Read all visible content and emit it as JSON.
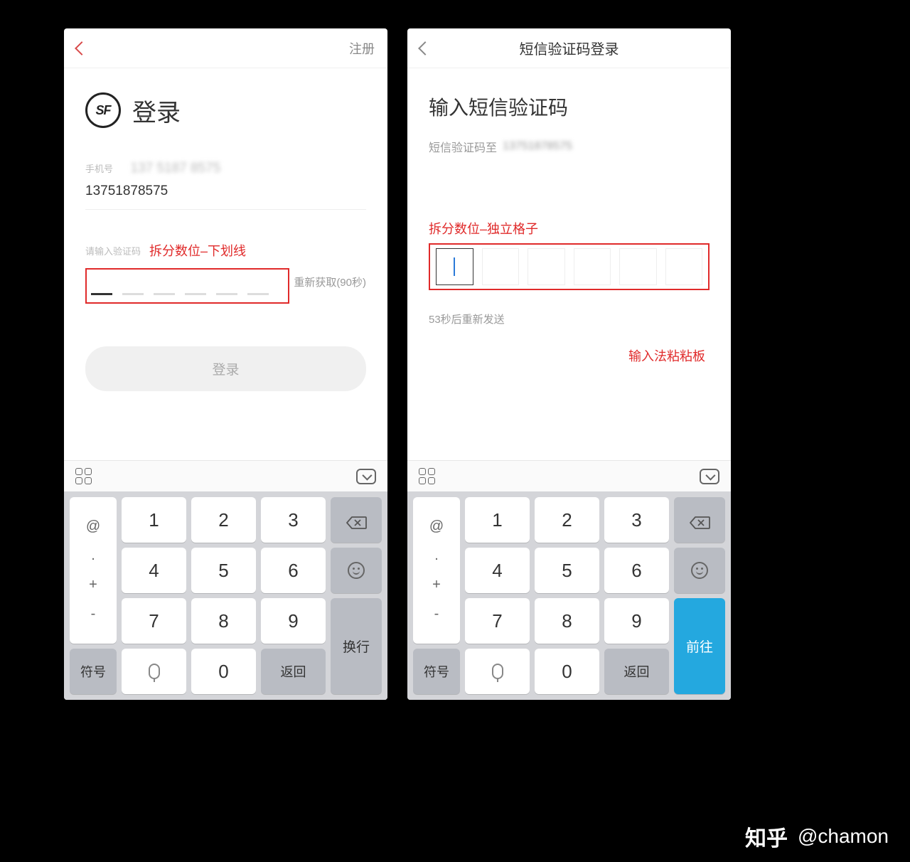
{
  "left": {
    "nav": {
      "register": "注册"
    },
    "brand": {
      "logo_text": "SF",
      "title": "登录"
    },
    "phone": {
      "label": "手机号",
      "blurred": "137 5187 8575",
      "value": "13751878575"
    },
    "code": {
      "label": "请输入验证码",
      "annotation": "拆分数位–下划线",
      "resend": "重新获取(90秒)"
    },
    "login_btn": "登录"
  },
  "right": {
    "nav": {
      "title": "短信验证码登录"
    },
    "title": "输入短信验证码",
    "subtitle": "短信验证码至",
    "sub_blur": "13751878575",
    "annotation": "拆分数位–独立格子",
    "resend": "53秒后重新发送",
    "paste_ann": "输入法粘粘板"
  },
  "keyboard": {
    "side": {
      "at": "@",
      "dot": ".",
      "plus": "+",
      "minus": "-"
    },
    "n1": "1",
    "n2": "2",
    "n3": "3",
    "n4": "4",
    "n5": "5",
    "n6": "6",
    "n7": "7",
    "n8": "8",
    "n9": "9",
    "n0": "0",
    "symbol": "符号",
    "back": "返回",
    "newline": "换行",
    "go": "前往"
  },
  "watermark": {
    "zhihu": "知乎",
    "author": "@chamon"
  }
}
